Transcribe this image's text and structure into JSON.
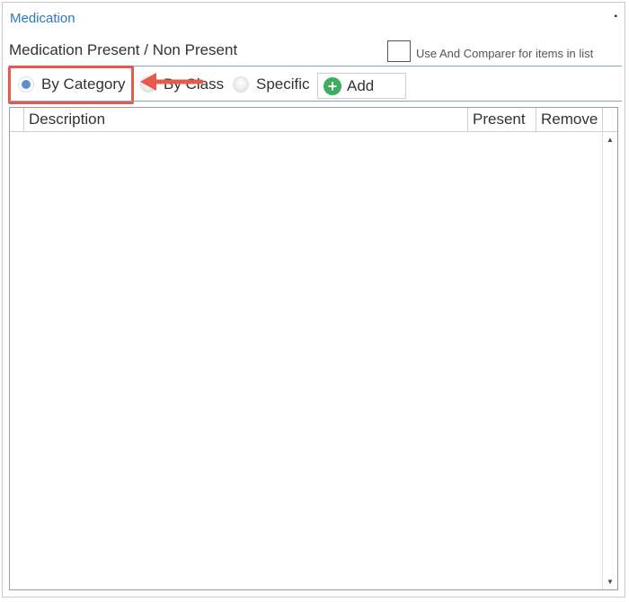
{
  "panel": {
    "title": "Medication",
    "pin_icon": "pin-icon",
    "section_label": "Medication Present / Non Present",
    "checkbox_label": "Use And Comparer for items in list",
    "checkbox_checked": false
  },
  "radios": {
    "selected": "by_category",
    "by_category": "By Category",
    "by_class": "By Class",
    "specific": "Specific"
  },
  "add_button": {
    "label": "Add",
    "icon": "plus-circle-icon",
    "icon_color": "#3cae5c"
  },
  "grid": {
    "columns": [
      "",
      "Description",
      "Present",
      "Remove",
      ""
    ],
    "rows": []
  },
  "annotation": {
    "highlight_color": "#e8584b",
    "arrow_color": "#e8584b",
    "target": "By Category"
  },
  "colors": {
    "accent": "#2a78c0",
    "rule": "#7aa6d4",
    "radio_selected": "#5b8fd3"
  }
}
